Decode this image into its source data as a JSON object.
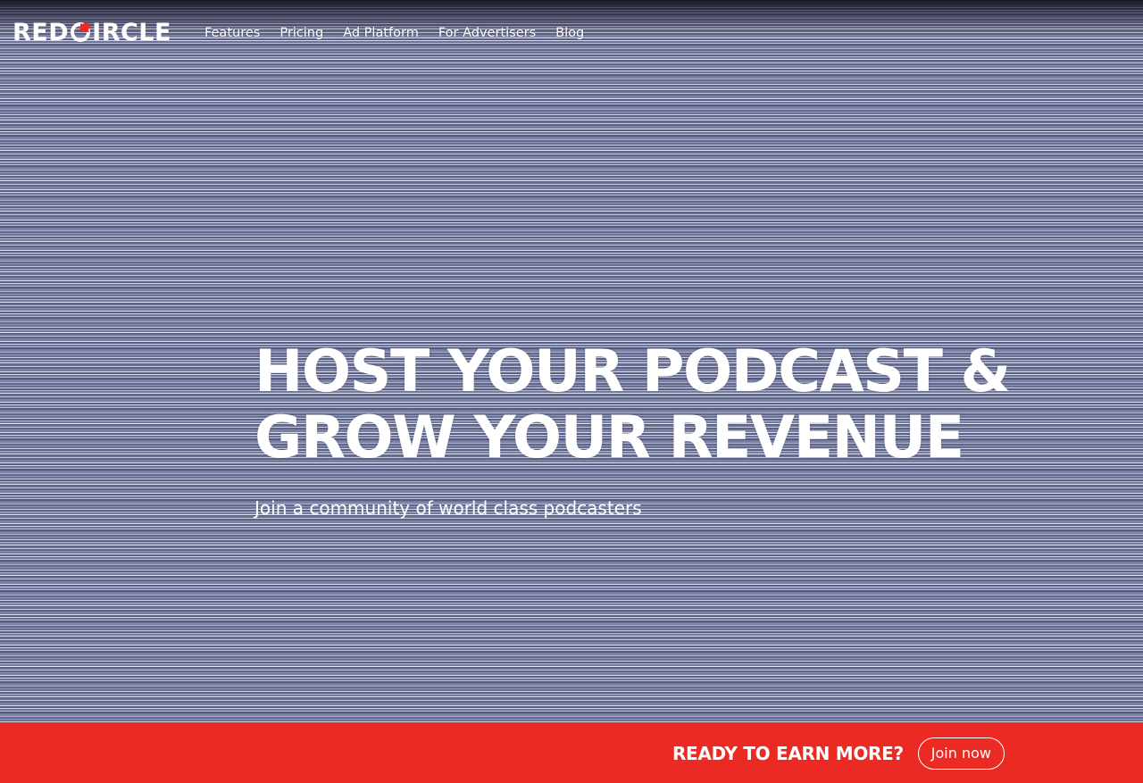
{
  "brand": {
    "logo_left": "RED",
    "logo_right": "IRCLE",
    "logo_icon": "red-circle-c-icon",
    "accent_color": "#ec2a24"
  },
  "nav": {
    "links": [
      {
        "label": "Features"
      },
      {
        "label": "Pricing"
      },
      {
        "label": "Ad Platform"
      },
      {
        "label": "For Advertisers"
      },
      {
        "label": "Blog"
      }
    ]
  },
  "hero": {
    "title_line_1": "HOST YOUR PODCAST &",
    "title_line_2": "GROW YOUR REVENUE",
    "subtitle": "Join a community of world class podcasters"
  },
  "cta_bar": {
    "text": "READY TO EARN MORE?",
    "button_label": "Join now",
    "background_color": "#ec2a24"
  }
}
